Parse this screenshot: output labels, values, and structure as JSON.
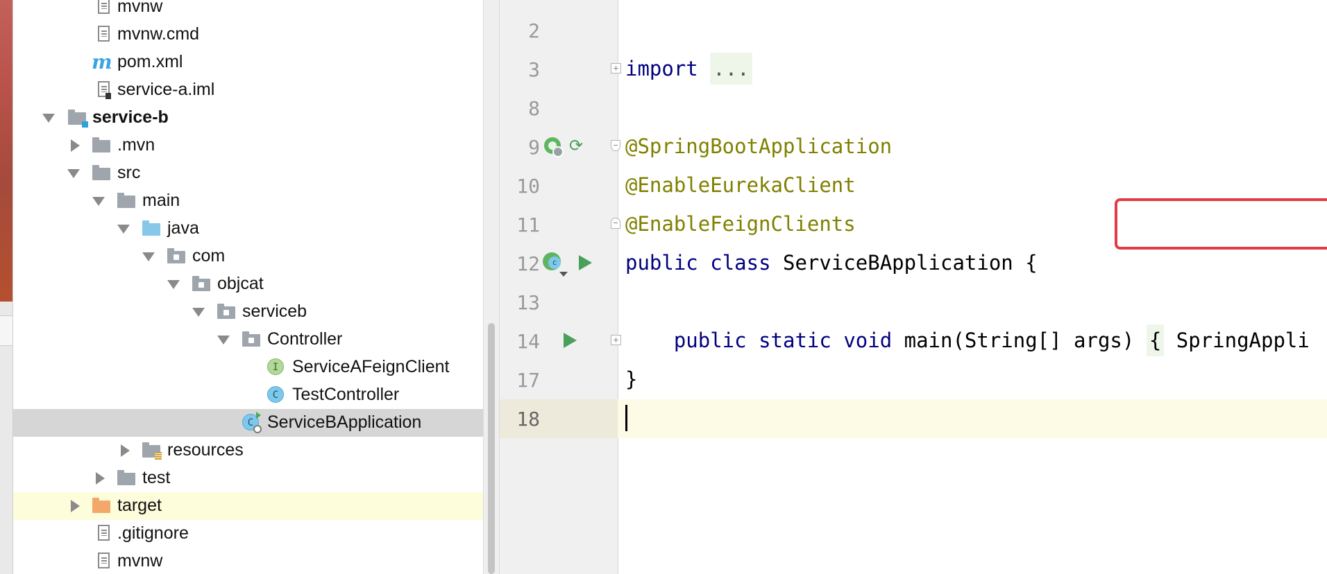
{
  "project_tree": {
    "rows": [
      {
        "label": "mvnw",
        "icon": "file-icon"
      },
      {
        "label": "mvnw.cmd",
        "icon": "file-icon"
      },
      {
        "label": "pom.xml",
        "icon": "maven-icon"
      },
      {
        "label": "service-a.iml",
        "icon": "module-file-icon"
      },
      {
        "label": "service-b",
        "icon": "module-folder-icon"
      },
      {
        "label": ".mvn",
        "icon": "folder-icon"
      },
      {
        "label": "src",
        "icon": "folder-icon"
      },
      {
        "label": "main",
        "icon": "folder-icon"
      },
      {
        "label": "java",
        "icon": "source-folder-icon"
      },
      {
        "label": "com",
        "icon": "package-icon"
      },
      {
        "label": "objcat",
        "icon": "package-icon"
      },
      {
        "label": "serviceb",
        "icon": "package-icon"
      },
      {
        "label": "Controller",
        "icon": "package-icon"
      },
      {
        "label": "ServiceAFeignClient",
        "icon": "interface-icon",
        "badge": "I"
      },
      {
        "label": "TestController",
        "icon": "class-icon",
        "badge": "C"
      },
      {
        "label": "ServiceBApplication",
        "icon": "spring-app-class-icon"
      },
      {
        "label": "resources",
        "icon": "resources-folder-icon"
      },
      {
        "label": "test",
        "icon": "folder-icon"
      },
      {
        "label": "target",
        "icon": "excluded-folder-icon"
      },
      {
        "label": ".gitignore",
        "icon": "file-icon"
      },
      {
        "label": "mvnw",
        "icon": "file-icon"
      }
    ],
    "selected": "ServiceBApplication"
  },
  "editor": {
    "lines": [
      {
        "num": "2"
      },
      {
        "num": "3",
        "keyword": "import",
        "folded": "..."
      },
      {
        "num": "8"
      },
      {
        "num": "9",
        "annotation": "@SpringBootApplication"
      },
      {
        "num": "10",
        "annotation": "@EnableEurekaClient"
      },
      {
        "num": "11",
        "annotation": "@EnableFeignClients"
      },
      {
        "num": "12",
        "kw1": "public",
        "kw2": "class",
        "rest": "ServiceBApplication {"
      },
      {
        "num": "13"
      },
      {
        "num": "14",
        "kw1": "public",
        "kw2": "static",
        "kw3": "void",
        "rest": "main(String[] args)",
        "brace": "{",
        "tail": "SpringAppli"
      },
      {
        "num": "17",
        "rest": "}"
      },
      {
        "num": "18"
      }
    ],
    "current_line": "18",
    "highlighted_line": "11"
  },
  "colors": {
    "annotation": "#808000",
    "keyword": "#000080",
    "highlight_box": "#e23b43"
  }
}
